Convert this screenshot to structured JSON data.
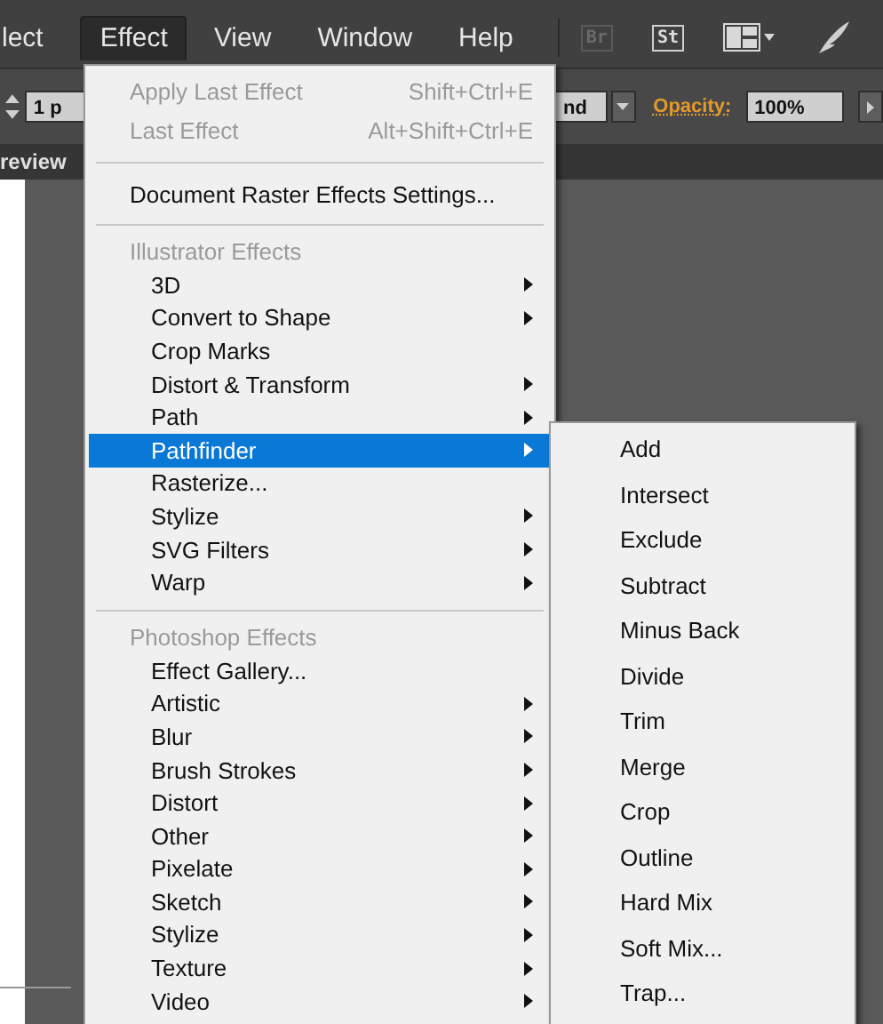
{
  "menubar": {
    "items": [
      {
        "label": "lect",
        "selected": false
      },
      {
        "label": "Effect",
        "selected": true
      },
      {
        "label": "View",
        "selected": false
      },
      {
        "label": "Window",
        "selected": false
      },
      {
        "label": "Help",
        "selected": false
      }
    ],
    "badges": [
      "Br",
      "St"
    ]
  },
  "control_bar": {
    "stroke_field": "1 p",
    "blend_field": "nd",
    "opacity_label": "Opacity:",
    "opacity_value": "100%"
  },
  "panel_tab": "review",
  "effect_menu": {
    "sections": [
      {
        "items": [
          {
            "label": "Apply Last Effect",
            "shortcut": "Shift+Ctrl+E",
            "disabled": true,
            "submenu": false,
            "selected": false
          },
          {
            "label": "Last Effect",
            "shortcut": "Alt+Shift+Ctrl+E",
            "disabled": true,
            "submenu": false,
            "selected": false
          }
        ]
      },
      {
        "items": [
          {
            "label": "Document Raster Effects Settings...",
            "disabled": false,
            "submenu": false,
            "selected": false
          }
        ]
      },
      {
        "header": "Illustrator Effects",
        "items": [
          {
            "label": "3D",
            "disabled": false,
            "submenu": true,
            "selected": false
          },
          {
            "label": "Convert to Shape",
            "disabled": false,
            "submenu": true,
            "selected": false
          },
          {
            "label": "Crop Marks",
            "disabled": false,
            "submenu": false,
            "selected": false
          },
          {
            "label": "Distort & Transform",
            "disabled": false,
            "submenu": true,
            "selected": false
          },
          {
            "label": "Path",
            "disabled": false,
            "submenu": true,
            "selected": false
          },
          {
            "label": "Pathfinder",
            "disabled": false,
            "submenu": true,
            "selected": true
          },
          {
            "label": "Rasterize...",
            "disabled": false,
            "submenu": false,
            "selected": false
          },
          {
            "label": "Stylize",
            "disabled": false,
            "submenu": true,
            "selected": false
          },
          {
            "label": "SVG Filters",
            "disabled": false,
            "submenu": true,
            "selected": false
          },
          {
            "label": "Warp",
            "disabled": false,
            "submenu": true,
            "selected": false
          }
        ]
      },
      {
        "header": "Photoshop Effects",
        "items": [
          {
            "label": "Effect Gallery...",
            "disabled": false,
            "submenu": false,
            "selected": false
          },
          {
            "label": "Artistic",
            "disabled": false,
            "submenu": true,
            "selected": false
          },
          {
            "label": "Blur",
            "disabled": false,
            "submenu": true,
            "selected": false
          },
          {
            "label": "Brush Strokes",
            "disabled": false,
            "submenu": true,
            "selected": false
          },
          {
            "label": "Distort",
            "disabled": false,
            "submenu": true,
            "selected": false
          },
          {
            "label": "Other",
            "disabled": false,
            "submenu": true,
            "selected": false
          },
          {
            "label": "Pixelate",
            "disabled": false,
            "submenu": true,
            "selected": false
          },
          {
            "label": "Sketch",
            "disabled": false,
            "submenu": true,
            "selected": false
          },
          {
            "label": "Stylize",
            "disabled": false,
            "submenu": true,
            "selected": false
          },
          {
            "label": "Texture",
            "disabled": false,
            "submenu": true,
            "selected": false
          },
          {
            "label": "Video",
            "disabled": false,
            "submenu": true,
            "selected": false
          }
        ]
      }
    ]
  },
  "pathfinder_submenu": {
    "items": [
      "Add",
      "Intersect",
      "Exclude",
      "Subtract",
      "Minus Back",
      "Divide",
      "Trim",
      "Merge",
      "Crop",
      "Outline",
      "Hard Mix",
      "Soft Mix...",
      "Trap..."
    ]
  }
}
